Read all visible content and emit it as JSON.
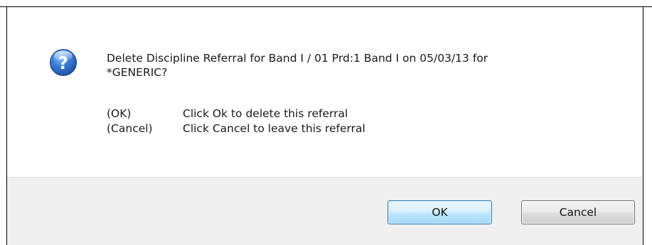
{
  "dialog": {
    "message_line1": "Delete Discipline Referral for Band I / 01 Prd:1 Band I on 05/03/13 for",
    "message_line2": "*GENERIC?",
    "icon": "question-icon",
    "options": [
      {
        "key": "(OK)",
        "text": "Click Ok to delete this referral"
      },
      {
        "key": "(Cancel)",
        "text": "Click Cancel to leave this referral"
      }
    ],
    "buttons": {
      "ok_label": "OK",
      "cancel_label": "Cancel"
    }
  },
  "colors": {
    "footer_bg": "#f0f0f0",
    "ok_border": "#3c7fb1",
    "icon_blue": "#2f6bc2"
  }
}
